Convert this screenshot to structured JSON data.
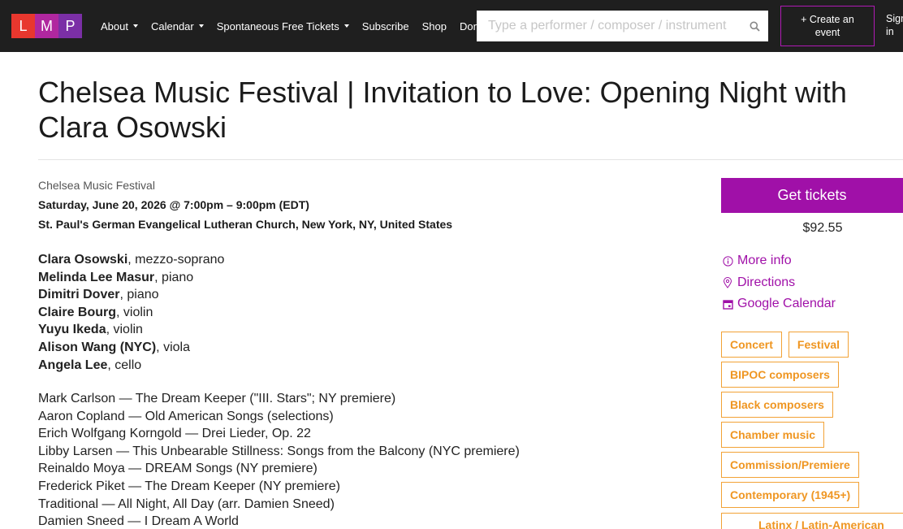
{
  "logo": {
    "letters": [
      "L",
      "M",
      "P"
    ],
    "colors": [
      "#e8372e",
      "#b0279f",
      "#7b2fa6"
    ]
  },
  "nav": {
    "items": [
      {
        "label": "About",
        "dropdown": true
      },
      {
        "label": "Calendar",
        "dropdown": true
      },
      {
        "label": "Spontaneous Free Tickets",
        "dropdown": true
      },
      {
        "label": "Subscribe",
        "dropdown": false
      },
      {
        "label": "Shop",
        "dropdown": false
      },
      {
        "label": "Donate",
        "dropdown": false
      }
    ],
    "search_placeholder": "Type a performer / composer / instrument",
    "search_icon": "search-icon",
    "create_label": "+ Create an event",
    "signin_label": "Sign in"
  },
  "event": {
    "title": "Chelsea Music Festival | Invitation to Love: Opening Night with Clara Osowski",
    "presenter": "Chelsea Music Festival",
    "date": "Saturday, June 20, 2026 @ 7:00pm – 9:00pm (EDT)",
    "venue": "St. Paul's German Evangelical Lutheran Church, New York, NY, United States"
  },
  "performers": [
    {
      "name": "Clara Osowski",
      "role": ", mezzo-soprano"
    },
    {
      "name": "Melinda Lee Masur",
      "role": ", piano"
    },
    {
      "name": "Dimitri Dover",
      "role": ", piano"
    },
    {
      "name": "Claire Bourg",
      "role": ", violin"
    },
    {
      "name": "Yuyu Ikeda",
      "role": ", violin"
    },
    {
      "name": "Alison Wang (NYC)",
      "role": ", viola"
    },
    {
      "name": "Angela Lee",
      "role": ", cello"
    }
  ],
  "program": [
    "Mark Carlson — The Dream Keeper (\"III. Stars\"; NY premiere)",
    "Aaron Copland — Old American Songs (selections)",
    "Erich Wolfgang Korngold — Drei Lieder, Op. 22",
    "Libby Larsen — This Unbearable Stillness: Songs from the Balcony (NYC premiere)",
    "Reinaldo Moya — DREAM Songs (NY premiere)",
    "Frederick Piket — The Dream Keeper (NY premiere)",
    "Traditional — All Night, All Day (arr. Damien Sneed)",
    "Damien Sneed — I Dream A World"
  ],
  "sidebar": {
    "tickets_label": "Get tickets",
    "price": "$92.55",
    "links": [
      {
        "label": "More info",
        "icon": "info-icon"
      },
      {
        "label": "Directions",
        "icon": "map-pin-icon"
      },
      {
        "label": "Google Calendar",
        "icon": "calendar-icon"
      }
    ],
    "tag_rows": [
      [
        "Concert",
        "Festival"
      ],
      [
        "BIPOC composers"
      ],
      [
        "Black composers"
      ],
      [
        "Chamber music"
      ],
      [
        "Commission/Premiere"
      ],
      [
        "Contemporary (1945+)"
      ]
    ],
    "tag_partial": "Latinx / Latin-American"
  },
  "colors": {
    "accent": "#a010a8",
    "tag": "#ef9622",
    "topbar": "#1f1f1f"
  }
}
